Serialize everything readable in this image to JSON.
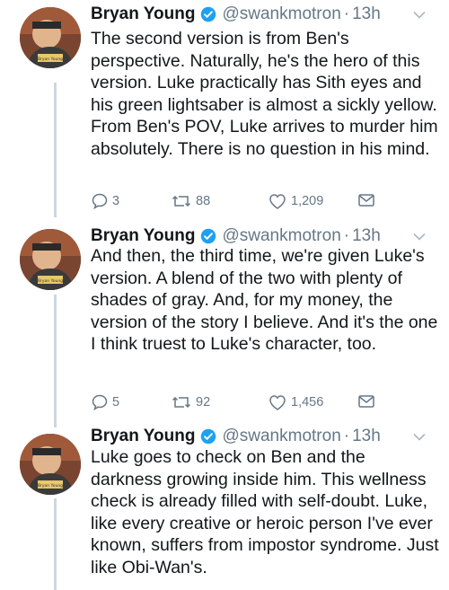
{
  "user": {
    "name": "Bryan Young",
    "handle": "@swankmotron",
    "separator": "·",
    "time": "13h",
    "avatar_caption": "Bryan Young"
  },
  "colors": {
    "verified": "#1da1f2",
    "muted": "#657786",
    "thread_line": "#ccd6dd"
  },
  "tweets": [
    {
      "text": "The second version is from Ben's perspective. Naturally, he's the hero of this version. Luke practically has Sith eyes and his green lightsaber is almost a sickly yellow. From Ben's POV, Luke arrives to murder him absolutely. There is no question in his mind.",
      "replies": "3",
      "retweets": "88",
      "likes": "1,209"
    },
    {
      "text": "And then, the third time, we're given Luke's version. A blend of the two with plenty of shades of gray. And, for my money, the version of the story I believe. And it's the one I think truest to Luke's character, too.",
      "replies": "5",
      "retweets": "92",
      "likes": "1,456"
    },
    {
      "text": "Luke goes to check on Ben and the darkness growing inside him. This wellness check is already filled with self-doubt. Luke, like every creative or heroic person I've ever known, suffers from impostor syndrome. Just like Obi-Wan's.",
      "replies": "",
      "retweets": "",
      "likes": ""
    }
  ]
}
